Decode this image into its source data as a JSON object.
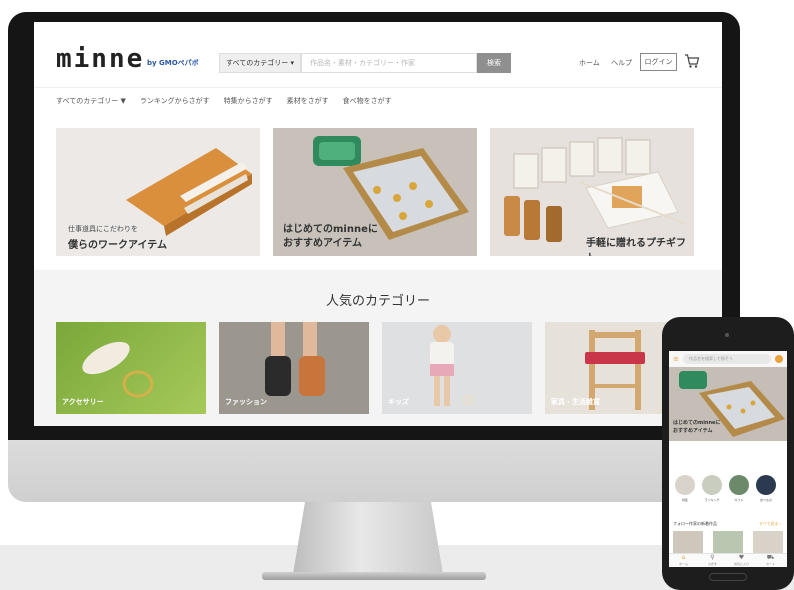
{
  "site": {
    "logo": "minne",
    "logo_sub": "by GMOペパボ",
    "category_select": "すべてのカテゴリー ▾",
    "search_placeholder": "作品名・素材・カテゴリー・作家",
    "search_button": "検索",
    "nav": {
      "home": "ホーム",
      "help": "ヘルプ",
      "login": "ログイン"
    },
    "subnav": [
      "すべてのカテゴリー ▼",
      "ランキングからさがす",
      "特集からさがす",
      "素材をさがす",
      "食べ物をさがす"
    ],
    "banners": [
      {
        "caption_small": "仕事道具にこだわりを",
        "caption": "僕らのワークアイテム"
      },
      {
        "caption_line1": "はじめてのminneに",
        "caption_line2": "おすすめアイテム"
      },
      {
        "caption": "手軽に贈れるプチギフト"
      }
    ],
    "popular_title": "人気のカテゴリー",
    "categories": [
      "アクセサリー",
      "ファッション",
      "キッズ",
      "家具・生活雑貨"
    ]
  },
  "phone": {
    "menu_icon": "≡",
    "search_placeholder": "作品名を検索して探そう",
    "hero_line1": "はじめてのminneに",
    "hero_line2": "おすすめアイテム",
    "circle_labels": [
      "特集",
      "ランキング",
      "ギフト",
      "食べもの"
    ],
    "circle_colors": [
      "#d8d3cb",
      "#c9cdbf",
      "#6c8a6a",
      "#2b3a4e"
    ],
    "follow_title": "フォロー作家の新着作品",
    "follow_more": "すべて見る ›",
    "tabs": [
      {
        "icon": "⌂",
        "label": "ホーム"
      },
      {
        "icon": "⚲",
        "label": "さがす"
      },
      {
        "icon": "♥",
        "label": "お気に入り"
      },
      {
        "icon": "⛟",
        "label": "カート"
      }
    ]
  },
  "colors": {
    "accent_orange": "#e8a33d",
    "search_button": "#8f8f8f"
  }
}
